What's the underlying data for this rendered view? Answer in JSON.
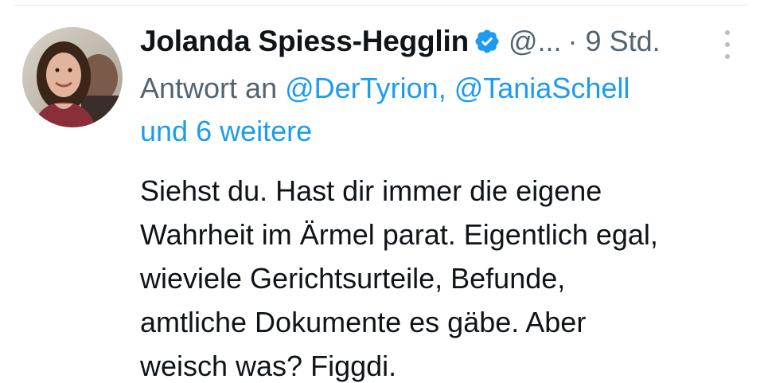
{
  "tweet": {
    "author_name": "Jolanda Spiess-Hegglin",
    "handle": "@...",
    "separator": "·",
    "time": "9 Std.",
    "reply_prefix": "Antwort an",
    "reply_mention_1": "@DerTyrion,",
    "reply_mention_2": "@TaniaSchell",
    "reply_others": "und 6 weitere",
    "body_lines": [
      "Siehst du. Hast dir immer die eigene",
      "Wahrheit im Ärmel parat. Eigentlich egal,",
      "wieviele Gerichtsurteile, Befunde,",
      "amtliche Dokumente es gäbe. Aber",
      "weisch was? Figgdi."
    ]
  },
  "icons": {
    "verified": "verified-badge-icon",
    "more": "more-vertical-icon",
    "avatar": "profile-photo"
  },
  "colors": {
    "text": "#0f1419",
    "secondary": "#536471",
    "link": "#1d9bf0",
    "verified": "#1d9bf0"
  }
}
